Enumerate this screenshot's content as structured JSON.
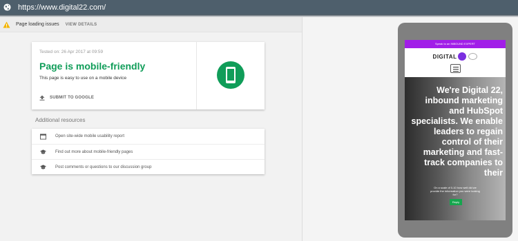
{
  "address_bar": {
    "url": "https://www.digital22.com/",
    "icon": "globe-icon"
  },
  "issues_bar": {
    "icon": "warning-icon",
    "text": "Page loading issues",
    "action": "VIEW DETAILS"
  },
  "result": {
    "tested_on": "Tested on: 26 Apr 2017 at 09:59",
    "headline": "Page is mobile-friendly",
    "subtext": "This page is easy to use on a mobile device",
    "submit_label": "SUBMIT TO GOOGLE",
    "submit_icon": "upload-icon",
    "badge_icon": "mobile-phone-icon"
  },
  "resources": {
    "title": "Additional resources",
    "items": [
      {
        "icon": "browser-window-icon",
        "label": "Open site-wide mobile usability report"
      },
      {
        "icon": "graduation-cap-icon",
        "label": "Find out more about mobile-friendly pages"
      },
      {
        "icon": "graduation-cap-icon",
        "label": "Post comments or questions to our discussion group"
      }
    ]
  },
  "preview": {
    "promo": "Speak to an INBOUND EXPERT",
    "logo_text": "DIGITAL",
    "menu_icon": "hamburger-menu-icon",
    "hero_title": "We're Digital 22, inbound marketing and HubSpot specialists. We enable leaders to regain control of their marketing and fast-track companies to their",
    "survey_question": "On a scale of 0-10 how well did we provide the information you were looking for?",
    "reply_label": "Reply"
  },
  "colors": {
    "top_bar": "#4e5f6c",
    "success_green": "#109d59",
    "promo_purple": "#a11ee8",
    "reply_green": "#15a64d",
    "warning_amber": "#f4b400"
  }
}
